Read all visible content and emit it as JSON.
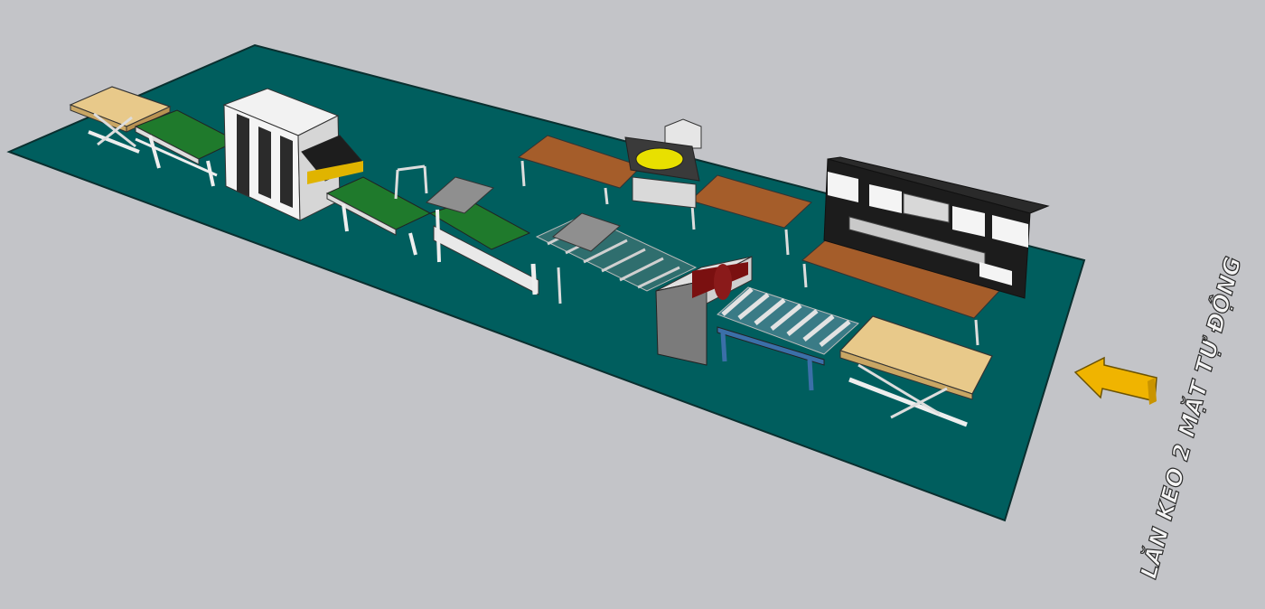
{
  "scene": {
    "caption": "LĂN KEO 2 MẶT TỰ ĐỘNG",
    "colors": {
      "background": "#c3c4c8",
      "floor": "#005e5e",
      "conveyor_belt": "#1f7a2c",
      "wood_top": "#a55d2a",
      "panel": "#e8c98a",
      "arrow": "#f0b400",
      "roller_blue": "#3b6fa8"
    },
    "icons": [
      "scissor-lift-table",
      "belt-conveyor",
      "glue-spreader-machine",
      "roller-conveyor",
      "work-bench",
      "control-cabinet",
      "direction-arrow"
    ]
  }
}
